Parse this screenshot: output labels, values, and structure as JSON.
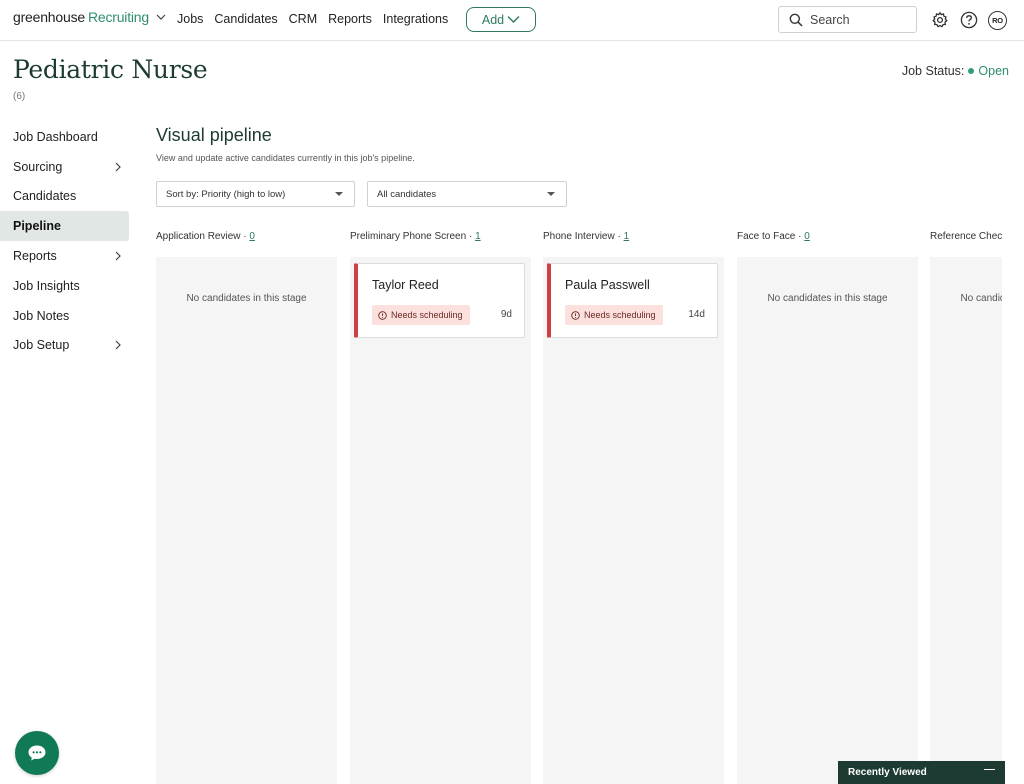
{
  "nav": {
    "brand": "greenhouse",
    "product": "Recruiting",
    "links": [
      "Jobs",
      "Candidates",
      "CRM",
      "Reports",
      "Integrations"
    ],
    "add_label": "Add",
    "search_placeholder": "Search",
    "avatar_initials": "RO"
  },
  "job": {
    "title": "Pediatric Nurse",
    "count": "(6)",
    "status_label": "Job Status:",
    "status_value": "Open"
  },
  "sidebar": {
    "items": [
      {
        "label": "Job Dashboard"
      },
      {
        "label": "Sourcing"
      },
      {
        "label": "Candidates"
      },
      {
        "label": "Pipeline"
      },
      {
        "label": "Reports"
      },
      {
        "label": "Job Insights"
      },
      {
        "label": "Job Notes"
      },
      {
        "label": "Job Setup"
      }
    ],
    "active": "Pipeline"
  },
  "pipeline": {
    "title": "Visual pipeline",
    "subtitle": "View and update active candidates currently in this job's pipeline.",
    "sort_value": "Sort by: Priority (high to low)",
    "filter_value": "All candidates",
    "empty_text": "No candidates in this stage",
    "stages": [
      {
        "name": "Application Review",
        "count": "0"
      },
      {
        "name": "Preliminary Phone Screen",
        "count": "1",
        "candidate": {
          "name": "Taylor Reed",
          "badge": "Needs scheduling",
          "days": "9d"
        }
      },
      {
        "name": "Phone Interview",
        "count": "1",
        "candidate": {
          "name": "Paula Passwell",
          "badge": "Needs scheduling",
          "days": "14d"
        }
      },
      {
        "name": "Face to Face",
        "count": "0"
      },
      {
        "name": "Reference Check",
        "count": ""
      }
    ]
  },
  "recently_viewed": "Recently Viewed",
  "colors": {
    "brand_green": "#2f8f6b",
    "heading": "#1d3b33",
    "alert_red": "#d04040",
    "badge_bg": "#fbe0dd"
  }
}
